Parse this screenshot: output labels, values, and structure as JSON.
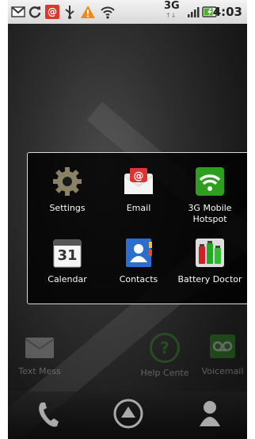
{
  "status_bar": {
    "icons": [
      "gmail-icon",
      "sync-icon",
      "email-notification-icon",
      "usb-icon",
      "warning-icon",
      "wifi-icon"
    ],
    "network_type": "3G",
    "battery_level": 0.8,
    "time": "4:03"
  },
  "folder": {
    "apps": [
      {
        "label": "Settings",
        "icon": "gear-icon"
      },
      {
        "label": "Email",
        "icon": "email-icon"
      },
      {
        "label": "3G Mobile Hotspot",
        "icon": "hotspot-icon"
      },
      {
        "label": "Calendar",
        "icon": "calendar-icon",
        "day": "31"
      },
      {
        "label": "Contacts",
        "icon": "contacts-icon"
      },
      {
        "label": "Battery Doctor",
        "icon": "battery-doctor-icon"
      }
    ]
  },
  "dock": {
    "apps": [
      {
        "label": "Text Mess",
        "icon": "messaging-icon"
      },
      {
        "label": "Help Cente",
        "icon": "help-icon",
        "glyph": "?"
      },
      {
        "label": "Voicemail",
        "icon": "voicemail-icon"
      }
    ]
  },
  "bottom_bar": {
    "buttons": [
      "phone-icon",
      "launcher-icon",
      "contacts-person-icon"
    ]
  }
}
